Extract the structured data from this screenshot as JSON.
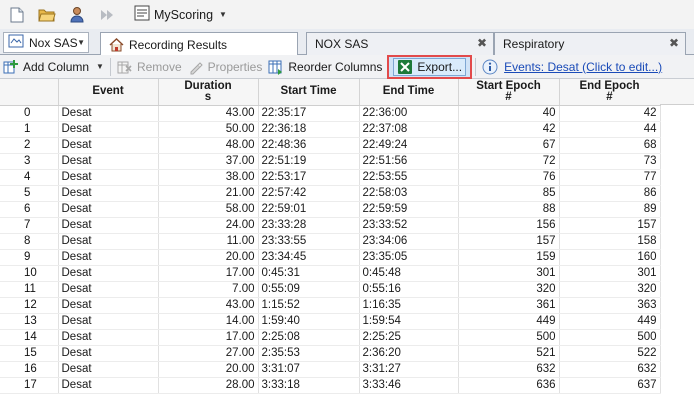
{
  "toolbar_top": {
    "icons": [
      "new-document-icon",
      "open-folder-icon",
      "user-icon",
      "forward-icon"
    ],
    "scoring_label": "MyScoring"
  },
  "tabs": {
    "patient": "Nox SAS",
    "recording_results": "Recording Results",
    "nox_sas": "NOX SAS",
    "respiratory": "Respiratory"
  },
  "toolbar2": {
    "add_column": "Add Column",
    "remove": "Remove",
    "properties": "Properties",
    "reorder_columns": "Reorder Columns",
    "export": "Export...",
    "events_link": "Events: Desat (Click to edit...)"
  },
  "colors": {
    "highlight_border": "#e24a4a",
    "link": "#1a4bb8",
    "excel_green": "#1d7a3a"
  },
  "table": {
    "columns": [
      {
        "line1": "",
        "line2": ""
      },
      {
        "line1": "Event",
        "line2": ""
      },
      {
        "line1": "Duration",
        "line2": "s"
      },
      {
        "line1": "Start Time",
        "line2": ""
      },
      {
        "line1": "End Time",
        "line2": ""
      },
      {
        "line1": "Start Epoch",
        "line2": "#"
      },
      {
        "line1": "End Epoch",
        "line2": "#"
      }
    ],
    "rows": [
      [
        "0",
        "Desat",
        "43.00",
        "22:35:17",
        "22:36:00",
        "40",
        "42"
      ],
      [
        "1",
        "Desat",
        "50.00",
        "22:36:18",
        "22:37:08",
        "42",
        "44"
      ],
      [
        "2",
        "Desat",
        "48.00",
        "22:48:36",
        "22:49:24",
        "67",
        "68"
      ],
      [
        "3",
        "Desat",
        "37.00",
        "22:51:19",
        "22:51:56",
        "72",
        "73"
      ],
      [
        "4",
        "Desat",
        "38.00",
        "22:53:17",
        "22:53:55",
        "76",
        "77"
      ],
      [
        "5",
        "Desat",
        "21.00",
        "22:57:42",
        "22:58:03",
        "85",
        "86"
      ],
      [
        "6",
        "Desat",
        "58.00",
        "22:59:01",
        "22:59:59",
        "88",
        "89"
      ],
      [
        "7",
        "Desat",
        "24.00",
        "23:33:28",
        "23:33:52",
        "156",
        "157"
      ],
      [
        "8",
        "Desat",
        "11.00",
        "23:33:55",
        "23:34:06",
        "157",
        "158"
      ],
      [
        "9",
        "Desat",
        "20.00",
        "23:34:45",
        "23:35:05",
        "159",
        "160"
      ],
      [
        "10",
        "Desat",
        "17.00",
        "0:45:31",
        "0:45:48",
        "301",
        "301"
      ],
      [
        "11",
        "Desat",
        "7.00",
        "0:55:09",
        "0:55:16",
        "320",
        "320"
      ],
      [
        "12",
        "Desat",
        "43.00",
        "1:15:52",
        "1:16:35",
        "361",
        "363"
      ],
      [
        "13",
        "Desat",
        "14.00",
        "1:59:40",
        "1:59:54",
        "449",
        "449"
      ],
      [
        "14",
        "Desat",
        "17.00",
        "2:25:08",
        "2:25:25",
        "500",
        "500"
      ],
      [
        "15",
        "Desat",
        "27.00",
        "2:35:53",
        "2:36:20",
        "521",
        "522"
      ],
      [
        "16",
        "Desat",
        "20.00",
        "3:31:07",
        "3:31:27",
        "632",
        "632"
      ],
      [
        "17",
        "Desat",
        "28.00",
        "3:33:18",
        "3:33:46",
        "636",
        "637"
      ]
    ]
  }
}
